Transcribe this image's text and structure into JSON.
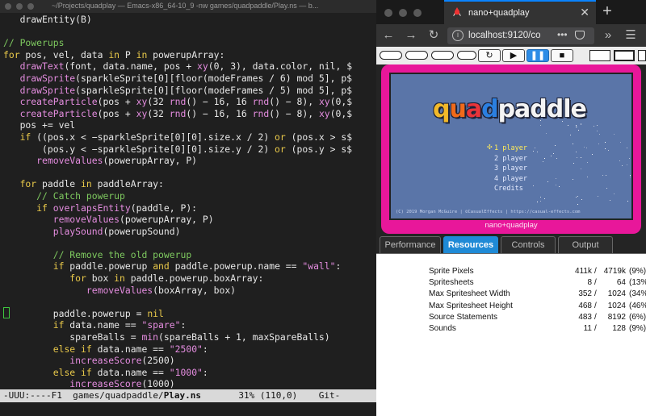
{
  "emacs": {
    "window_title": "~/Projects/quadplay — Emacs-x86_64-10_9 -nw games/quadpaddle/Play.ns — b...",
    "code_lines": [
      [
        [
          "pl",
          "   drawEntity(B)"
        ]
      ],
      [
        [
          "pl",
          ""
        ]
      ],
      [
        [
          "cm",
          "// Powerups"
        ]
      ],
      [
        [
          "kw",
          "for"
        ],
        [
          "pl",
          " pos, vel, data "
        ],
        [
          "kw",
          "in"
        ],
        [
          "pl",
          " P "
        ],
        [
          "kw",
          "in"
        ],
        [
          "pl",
          " powerupArray:"
        ]
      ],
      [
        [
          "pl",
          "   "
        ],
        [
          "fn",
          "drawText"
        ],
        [
          "pl",
          "(font, data.name, pos + "
        ],
        [
          "fn",
          "xy"
        ],
        [
          "pl",
          "(0, 3), data.color, nil, $"
        ]
      ],
      [
        [
          "pl",
          "   "
        ],
        [
          "fn",
          "drawSprite"
        ],
        [
          "pl",
          "(sparkleSprite[0][floor(modeFrames / 6) mod 5], p$"
        ]
      ],
      [
        [
          "pl",
          "   "
        ],
        [
          "fn",
          "drawSprite"
        ],
        [
          "pl",
          "(sparkleSprite[0][floor(modeFrames / 5) mod 5], p$"
        ]
      ],
      [
        [
          "pl",
          "   "
        ],
        [
          "fn",
          "createParticle"
        ],
        [
          "pl",
          "(pos + "
        ],
        [
          "fn",
          "xy"
        ],
        [
          "pl",
          "(32 "
        ],
        [
          "fn",
          "rnd"
        ],
        [
          "pl",
          "() − 16, 16 "
        ],
        [
          "fn",
          "rnd"
        ],
        [
          "pl",
          "() − 8), "
        ],
        [
          "fn",
          "xy"
        ],
        [
          "pl",
          "(0,$"
        ]
      ],
      [
        [
          "pl",
          "   "
        ],
        [
          "fn",
          "createParticle"
        ],
        [
          "pl",
          "(pos + "
        ],
        [
          "fn",
          "xy"
        ],
        [
          "pl",
          "(32 "
        ],
        [
          "fn",
          "rnd"
        ],
        [
          "pl",
          "() − 16, 16 "
        ],
        [
          "fn",
          "rnd"
        ],
        [
          "pl",
          "() − 8), "
        ],
        [
          "fn",
          "xy"
        ],
        [
          "pl",
          "(0,$"
        ]
      ],
      [
        [
          "pl",
          "   pos += vel"
        ]
      ],
      [
        [
          "pl",
          "   "
        ],
        [
          "kw",
          "if"
        ],
        [
          "pl",
          " ((pos.x < −sparkleSprite[0][0].size.x / 2) "
        ],
        [
          "kw",
          "or"
        ],
        [
          "pl",
          " (pos.x > s$"
        ]
      ],
      [
        [
          "pl",
          "       (pos.y < −sparkleSprite[0][0].size.y / 2) "
        ],
        [
          "kw",
          "or"
        ],
        [
          "pl",
          " (pos.y > s$"
        ]
      ],
      [
        [
          "pl",
          "      "
        ],
        [
          "fn",
          "removeValues"
        ],
        [
          "pl",
          "(powerupArray, P)"
        ]
      ],
      [
        [
          "pl",
          ""
        ]
      ],
      [
        [
          "pl",
          "   "
        ],
        [
          "kw",
          "for"
        ],
        [
          "pl",
          " paddle "
        ],
        [
          "kw",
          "in"
        ],
        [
          "pl",
          " paddleArray:"
        ]
      ],
      [
        [
          "pl",
          "      "
        ],
        [
          "cm",
          "// Catch powerup"
        ]
      ],
      [
        [
          "pl",
          "      "
        ],
        [
          "kw",
          "if"
        ],
        [
          "pl",
          " "
        ],
        [
          "fn",
          "overlapsEntity"
        ],
        [
          "pl",
          "(paddle, P):"
        ]
      ],
      [
        [
          "pl",
          "         "
        ],
        [
          "fn",
          "removeValues"
        ],
        [
          "pl",
          "(powerupArray, P)"
        ]
      ],
      [
        [
          "pl",
          "         "
        ],
        [
          "fn",
          "playSound"
        ],
        [
          "pl",
          "(powerupSound)"
        ]
      ],
      [
        [
          "pl",
          ""
        ]
      ],
      [
        [
          "pl",
          "         "
        ],
        [
          "cm",
          "// Remove the old powerup"
        ]
      ],
      [
        [
          "pl",
          "         "
        ],
        [
          "kw",
          "if"
        ],
        [
          "pl",
          " paddle.powerup "
        ],
        [
          "kw",
          "and"
        ],
        [
          "pl",
          " paddle.powerup.name == "
        ],
        [
          "st",
          "\"wall\""
        ],
        [
          "pl",
          ":"
        ]
      ],
      [
        [
          "pl",
          "            "
        ],
        [
          "kw",
          "for"
        ],
        [
          "pl",
          " box "
        ],
        [
          "kw",
          "in"
        ],
        [
          "pl",
          " paddle.powerup.boxArray:"
        ]
      ],
      [
        [
          "pl",
          "               "
        ],
        [
          "fn",
          "removeValues"
        ],
        [
          "pl",
          "(boxArray, box)"
        ]
      ],
      [
        [
          "pl",
          ""
        ]
      ],
      [
        [
          "pl",
          "         paddle.powerup = "
        ],
        [
          "kw",
          "nil"
        ]
      ],
      [
        [
          "pl",
          "         "
        ],
        [
          "kw",
          "if"
        ],
        [
          "pl",
          " data.name == "
        ],
        [
          "st",
          "\"spare\""
        ],
        [
          "pl",
          ":"
        ]
      ],
      [
        [
          "pl",
          "            spareBalls = "
        ],
        [
          "fn",
          "min"
        ],
        [
          "pl",
          "(spareBalls + 1, maxSpareBalls)"
        ]
      ],
      [
        [
          "pl",
          "         "
        ],
        [
          "kw",
          "else if"
        ],
        [
          "pl",
          " data.name == "
        ],
        [
          "st",
          "\"2500\""
        ],
        [
          "pl",
          ":"
        ]
      ],
      [
        [
          "pl",
          "            "
        ],
        [
          "fn",
          "increaseScore"
        ],
        [
          "pl",
          "(2500)"
        ]
      ],
      [
        [
          "pl",
          "         "
        ],
        [
          "kw",
          "else if"
        ],
        [
          "pl",
          " data.name == "
        ],
        [
          "st",
          "\"1000\""
        ],
        [
          "pl",
          ":"
        ]
      ],
      [
        [
          "pl",
          "            "
        ],
        [
          "fn",
          "increaseScore"
        ],
        [
          "pl",
          "(1000)"
        ]
      ]
    ],
    "modeline": {
      "prefix": "-UUU:----F1  games/quadpaddle/",
      "filename": "Play.ns",
      "suffix": "       31% (110,0)    Git-"
    }
  },
  "browser": {
    "tab_title": "nano+quadplay",
    "tab_close": "✕",
    "new_tab": "+",
    "nav": {
      "back": "←",
      "forward": "→",
      "reload": "↻",
      "url": "localhost:9120/co",
      "page_actions": "•••",
      "overflow": "»",
      "menu": "☰"
    },
    "toolbar": {
      "restart": "↻",
      "play": "▶",
      "pause": "❚❚",
      "stop": "■"
    },
    "game": {
      "logo": [
        "q",
        "u",
        "a",
        "d",
        "paddle"
      ],
      "menu_items": [
        "1 player",
        "2 player",
        "3 player",
        "4 player",
        "Credits"
      ],
      "selected_index": 0,
      "cursor": "✣",
      "copyright": "(C) 2019 Morgan McGuire | ©CasualEffects | https://casual-effects.com"
    },
    "console_label": "nano+quadplay",
    "dev_tabs": [
      "Performance",
      "Resources",
      "Controls",
      "Output"
    ],
    "active_dev_tab": "Resources",
    "resources": [
      {
        "name": "Sprite Pixels",
        "used": "411k",
        "max": "4719k",
        "pct": "(9%)"
      },
      {
        "name": "Spritesheets",
        "used": "8",
        "max": "64",
        "pct": "(13%)"
      },
      {
        "name": "Max Spritesheet Width",
        "used": "352",
        "max": "1024",
        "pct": "(34%)"
      },
      {
        "name": "Max Spritesheet Height",
        "used": "468",
        "max": "1024",
        "pct": "(46%)"
      },
      {
        "name": "Source Statements",
        "used": "483",
        "max": "8192",
        "pct": "(6%)"
      },
      {
        "name": "Sounds",
        "used": "11",
        "max": "128",
        "pct": "(9%)"
      }
    ]
  }
}
